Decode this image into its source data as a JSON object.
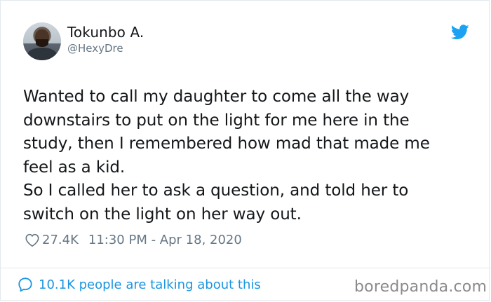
{
  "user": {
    "name": "Tokunbo A.",
    "handle": "@HexyDre"
  },
  "tweet": {
    "text": "Wanted to call my daughter to come all the way\ndownstairs to put on the light for me here in the\nstudy, then I remembered how mad that made me\nfeel as a kid.\nSo I called her to ask a question, and told her to\nswitch on the light on her way out.",
    "likes": "27.4K",
    "timestamp": "11:30 PM - Apr 18, 2020"
  },
  "footer": {
    "talking": "10.1K people are talking about this"
  },
  "watermark": "boredpanda.com",
  "colors": {
    "twitter_blue": "#1da1f2",
    "link_blue": "#1b95e0",
    "muted_gray": "#657786",
    "text": "#14171a",
    "border": "#e1e8ed"
  },
  "icons": [
    "twitter-bird-icon",
    "heart-icon",
    "speech-bubble-icon"
  ]
}
